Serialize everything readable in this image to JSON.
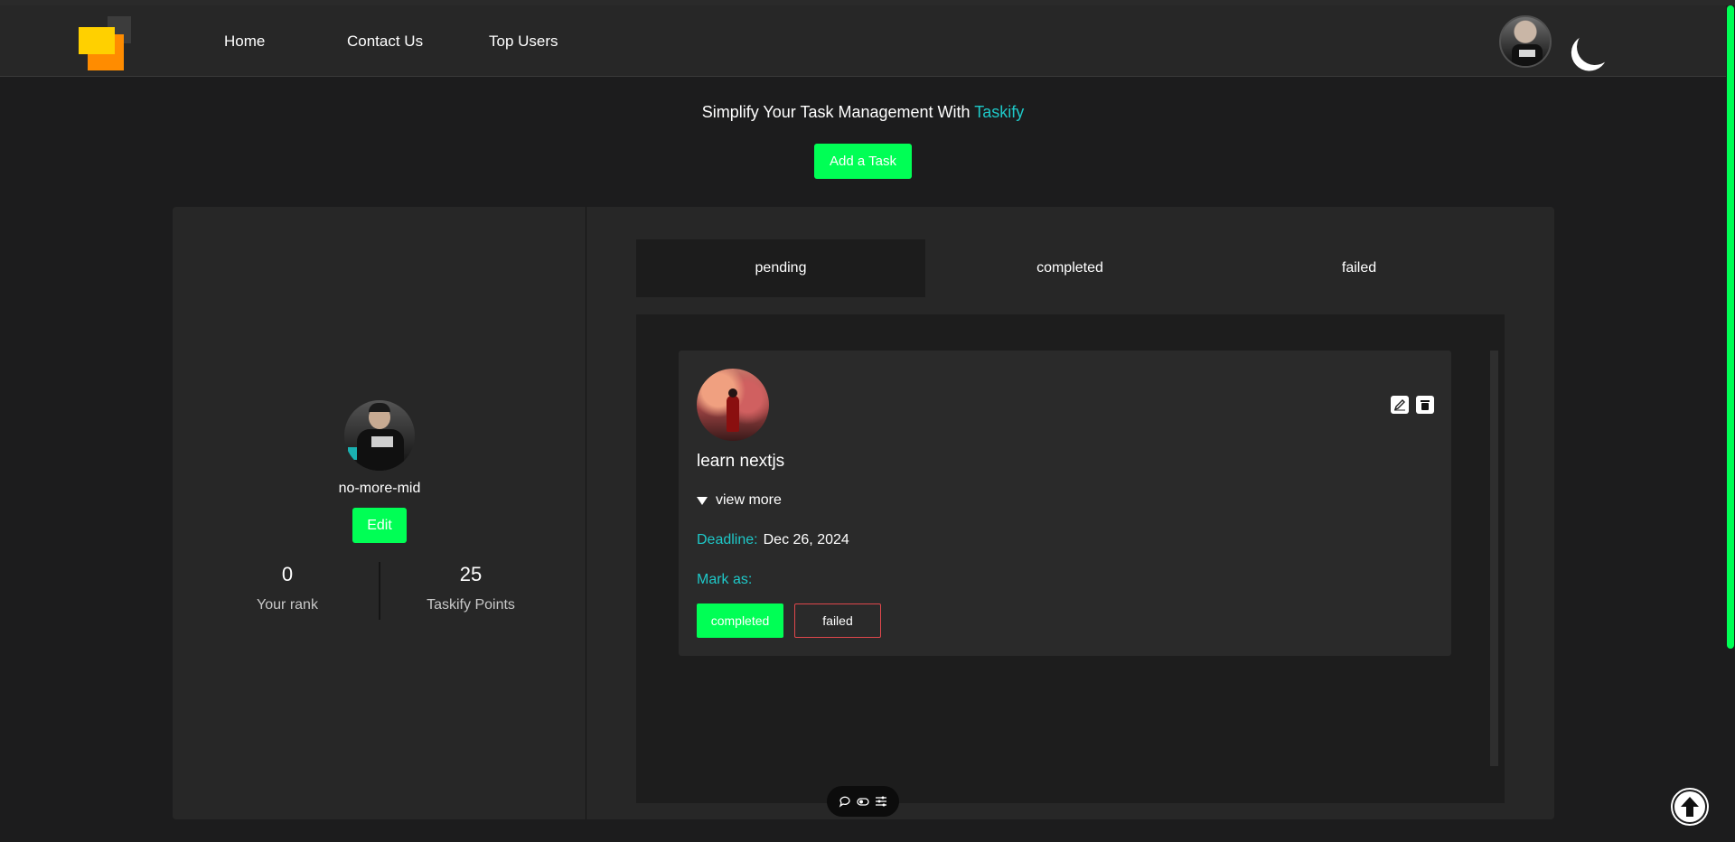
{
  "nav": {
    "links": [
      "Home",
      "Contact Us",
      "Top Users"
    ]
  },
  "hero": {
    "tagline_prefix": "Simplify Your Task Management With ",
    "brand": "Taskify",
    "add_task_label": "Add a Task"
  },
  "profile": {
    "username": "no-more-mid",
    "edit_label": "Edit",
    "rank_value": "0",
    "rank_label": "Your rank",
    "points_value": "25",
    "points_label": "Taskify Points"
  },
  "tabs": {
    "items": [
      "pending",
      "completed",
      "failed"
    ],
    "active": "pending"
  },
  "task": {
    "title": "learn nextjs",
    "view_more": "view more",
    "deadline_label": "Deadline:",
    "deadline_value": "Dec 26, 2024",
    "mark_as_label": "Mark as:",
    "completed_label": "completed",
    "failed_label": "failed"
  },
  "icons": {
    "edit": "edit-icon",
    "delete": "trash-icon",
    "theme": "moon-icon",
    "scroll_top": "arrow-up-icon",
    "pill": [
      "chat-icon",
      "toggle-icon",
      "sliders-icon"
    ]
  },
  "colors": {
    "accent_green": "#00ff55",
    "brand_teal": "#1ec8c8",
    "danger_red": "#e0474c",
    "logo_yellow": "#ffd000",
    "logo_orange": "#ff8c00"
  }
}
